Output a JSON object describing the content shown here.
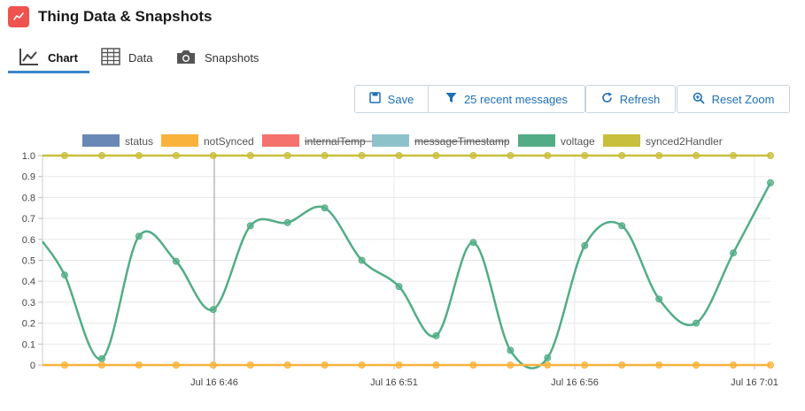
{
  "header": {
    "title": "Thing Data & Snapshots",
    "icon": "line-chart-icon",
    "accent": "#ef5350"
  },
  "tabs": [
    {
      "label": "Chart",
      "icon": "line-chart-icon",
      "active": true
    },
    {
      "label": "Data",
      "icon": "table-icon",
      "active": false
    },
    {
      "label": "Snapshots",
      "icon": "camera-icon",
      "active": false
    }
  ],
  "toolbar": {
    "save_label": "Save",
    "messages_label": "25 recent messages",
    "refresh_label": "Refresh",
    "reset_zoom_label": "Reset Zoom"
  },
  "chart_data": {
    "type": "line",
    "ylim": [
      0,
      1
    ],
    "y_ticks": [
      "0",
      "0.1",
      "0.2",
      "0.3",
      "0.4",
      "0.5",
      "0.6",
      "0.7",
      "0.8",
      "0.9",
      "1.0"
    ],
    "x_tick_labels": [
      "Jul 16 6:46",
      "Jul 16 6:51",
      "Jul 16 6:56",
      "Jul 16 7:01"
    ],
    "grid": true,
    "legend_position": "top",
    "legend": [
      {
        "name": "status",
        "color": "#6a88b5",
        "hidden": false
      },
      {
        "name": "notSynced",
        "color": "#f9b23b",
        "hidden": false
      },
      {
        "name": "internalTemp",
        "color": "#f4716d",
        "hidden": true
      },
      {
        "name": "messageTimestamp",
        "color": "#8ec2cb",
        "hidden": true
      },
      {
        "name": "voltage",
        "color": "#52ad86",
        "hidden": false
      },
      {
        "name": "synced2Handler",
        "color": "#c8bf3c",
        "hidden": false
      }
    ],
    "series": [
      {
        "name": "voltage",
        "color": "#52ad86",
        "values": [
          0.59,
          0.43,
          0.03,
          0.615,
          0.495,
          0.265,
          0.665,
          0.68,
          0.75,
          0.5,
          0.375,
          0.14,
          0.585,
          0.07,
          0.035,
          0.57,
          0.665,
          0.315,
          0.2,
          0.535,
          0.87
        ]
      },
      {
        "name": "synced2Handler",
        "color": "#c8bf3c",
        "values": [
          1,
          1,
          1,
          1,
          1,
          1,
          1,
          1,
          1,
          1,
          1,
          1,
          1,
          1,
          1,
          1,
          1,
          1,
          1,
          1,
          1
        ]
      },
      {
        "name": "notSynced",
        "color": "#f9b23b",
        "values": [
          0,
          0,
          0,
          0,
          0,
          0,
          0,
          0,
          0,
          0,
          0,
          0,
          0,
          0,
          0,
          0,
          0,
          0,
          0,
          0,
          0
        ]
      }
    ]
  }
}
